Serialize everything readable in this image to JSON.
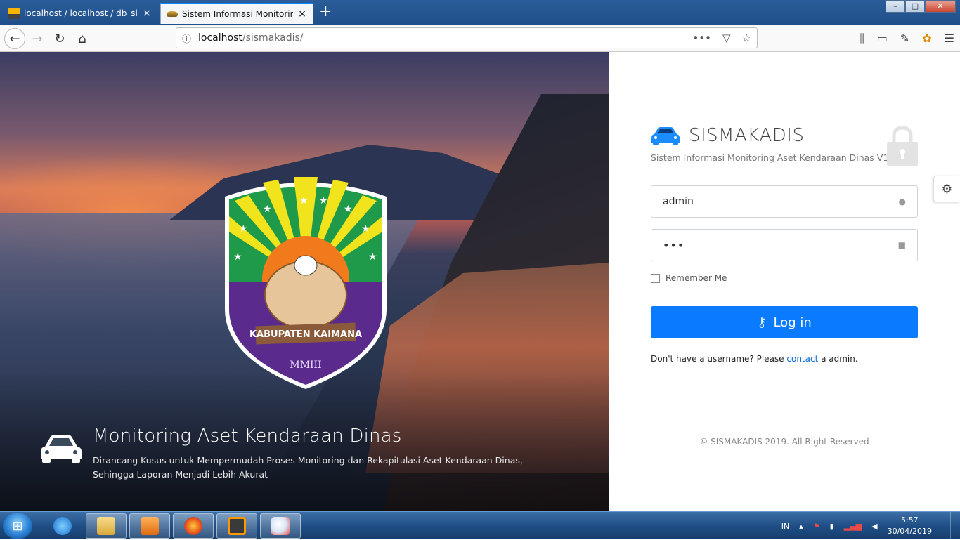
{
  "browser": {
    "tabs": [
      {
        "title": "localhost / localhost / db_sisma",
        "favicon": "phpmyadmin-icon",
        "active": false
      },
      {
        "title": "Sistem Informasi Monitoring A",
        "favicon": "car-favicon-icon",
        "active": true
      }
    ],
    "url_host": "localhost",
    "url_path": "/sismakadis/",
    "window_buttons": {
      "minimize": "–",
      "maximize": "□",
      "close": "✕"
    }
  },
  "hero": {
    "crest_ribbon_text": "KABUPATEN KAIMANA",
    "crest_year": "MMIII",
    "title": "Monitoring Aset Kendaraan Dinas",
    "description": "Dirancang Kusus untuk Mempermudah Proses Monitoring dan Rekapitulasi Aset Kendaraan Dinas, Sehingga Laporan Menjadi Lebih Akurat"
  },
  "login": {
    "app_name": "SISMAKADIS",
    "app_subtitle": "Sistem Informasi Monitoring Aset Kendaraan Dinas V1.0",
    "username_value": "admin",
    "password_mask": "•••",
    "remember_label": "Remember Me",
    "login_button": "Log in",
    "help_prefix": "Don't have a username? Please ",
    "help_link": "contact",
    "help_suffix": " a admin.",
    "footer": "© SISMAKADIS 2019. All Right Reserved",
    "accent_color": "#0a7bff"
  },
  "taskbar": {
    "language": "IN",
    "time": "5:57",
    "date": "30/04/2019"
  }
}
